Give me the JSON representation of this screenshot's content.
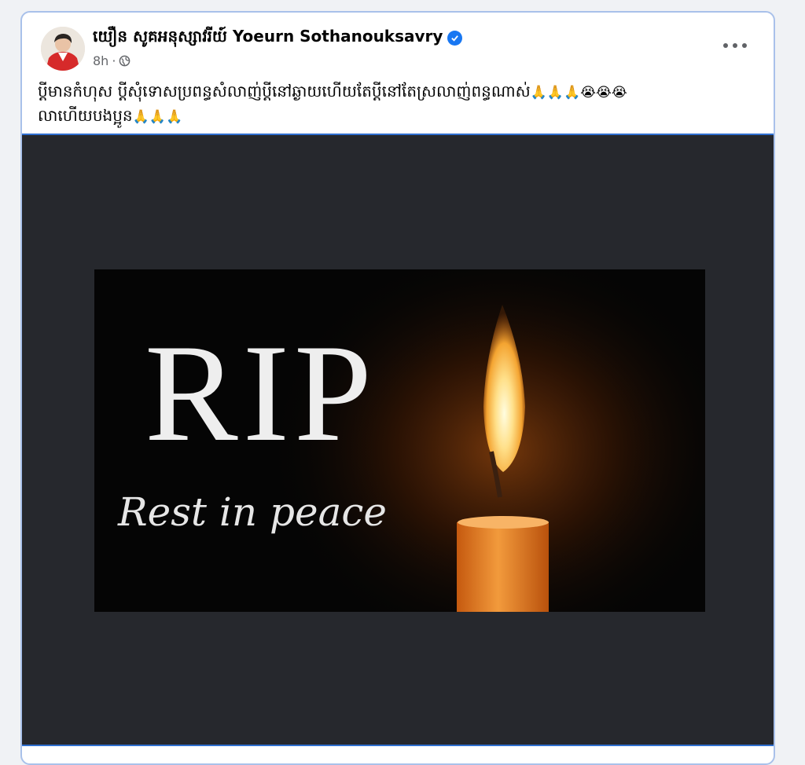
{
  "post": {
    "author_name": "យឿន សូគអនុស្សាវរីយ៍ Yoeurn Sothanouksavry",
    "verified": true,
    "time": "8h",
    "separator": "·",
    "privacy_icon": "globe-icon",
    "more_icon": "more-options-icon",
    "caption_line1": "ប្ដីមានកំហុស ប្ដីសុំទោសប្រពន្ធសំលាញ់ប្ដីនៅឆ្ងាយហើយតែប្ដីនៅតែស្រលាញ់ពន្ធណាស់",
    "caption_line1_emojis": "🙏🙏🙏😭😭😭",
    "caption_line2": "លាហើយបងប្អូន",
    "caption_line2_emojis": "🙏🙏🙏"
  },
  "image": {
    "title": "RIP",
    "subtitle": "Rest in peace"
  },
  "colors": {
    "verified_blue": "#1877f2",
    "media_background": "#26282d",
    "candle_orange": "#e08a2c"
  }
}
